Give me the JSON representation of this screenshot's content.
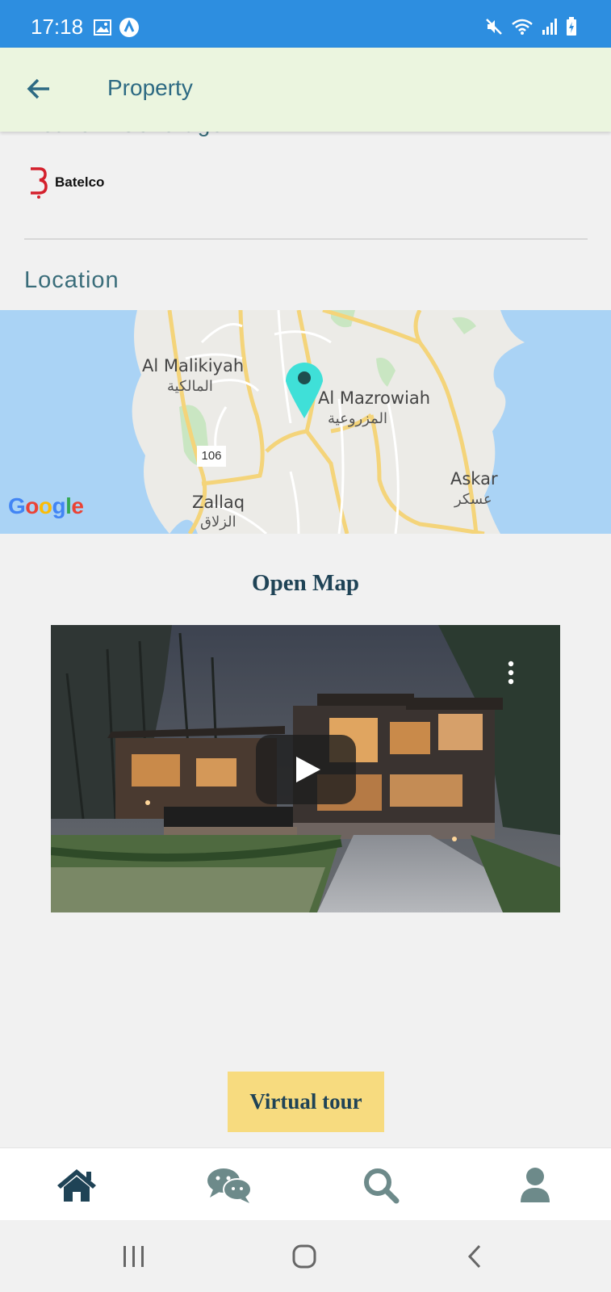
{
  "status_bar": {
    "time": "17:18",
    "left_icons": [
      "image-icon",
      "a-circle-icon"
    ],
    "right_icons": [
      "mute-icon",
      "wifi-icon",
      "signal-icon",
      "battery-charging-icon"
    ]
  },
  "app_bar": {
    "title": "Property",
    "back_icon": "arrow-left-icon"
  },
  "content": {
    "network_coverage_heading": "Network Coverage",
    "provider": {
      "name": "Batelco"
    },
    "location_heading": "Location",
    "map": {
      "places": [
        {
          "name": "Al Malikiyah",
          "name_ar": "المالكية"
        },
        {
          "name": "Al Mazrowiah",
          "name_ar": "المزروعية"
        },
        {
          "name": "Zallaq",
          "name_ar": "الزلاق"
        },
        {
          "name": "Askar",
          "name_ar": "عسكر"
        }
      ],
      "road_number": "106",
      "attribution": "Google",
      "marker_icon": "map-pin-icon"
    },
    "open_map_label": "Open Map",
    "video": {
      "play_icon": "play-icon",
      "menu_icon": "more-vertical-icon"
    },
    "virtual_tour_label": "Virtual tour"
  },
  "bottom_nav": {
    "items": [
      {
        "icon": "home-icon"
      },
      {
        "icon": "chat-icon"
      },
      {
        "icon": "search-icon"
      },
      {
        "icon": "user-icon"
      }
    ]
  },
  "system_nav": {
    "items": [
      {
        "icon": "recent-apps-icon"
      },
      {
        "icon": "home-circle-icon"
      },
      {
        "icon": "back-chevron-icon"
      }
    ]
  },
  "colors": {
    "status_bar": "#2d8ee0",
    "app_bar": "#ebf5df",
    "accent_text": "#2d6a83",
    "heading_dark": "#1f4356",
    "button_yellow": "#f7db7f",
    "map_water": "#aad3f5",
    "marker": "#3fe0d8",
    "nav_icon": "#6d8a8a",
    "nav_icon_active": "#1f4356"
  }
}
